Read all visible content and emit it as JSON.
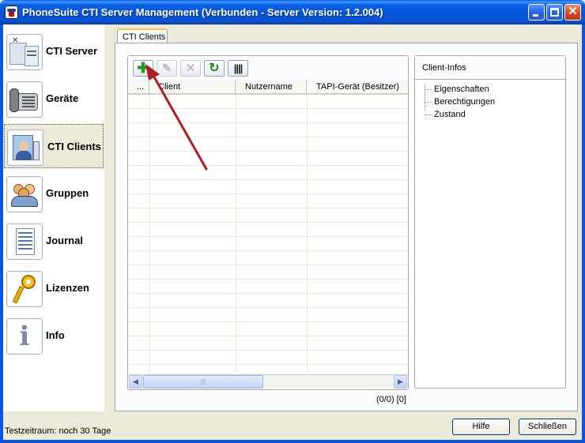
{
  "window": {
    "title": "PhoneSuite CTI Server Management (Verbunden - Server Version: 1.2.004)"
  },
  "nav": {
    "items": [
      {
        "label": "CTI Server",
        "icon": "server-icon"
      },
      {
        "label": "Geräte",
        "icon": "phone-icon"
      },
      {
        "label": "CTI Clients",
        "icon": "client-user-icon",
        "selected": true
      },
      {
        "label": "Gruppen",
        "icon": "group-icon"
      },
      {
        "label": "Journal",
        "icon": "journal-icon"
      },
      {
        "label": "Lizenzen",
        "icon": "key-icon"
      },
      {
        "label": "Info",
        "icon": "info-icon"
      }
    ]
  },
  "tab": {
    "label": "CTI Clients"
  },
  "toolbar": {
    "tools": [
      "add-icon",
      "edit-icon",
      "delete-icon",
      "refresh-icon",
      "columns-icon"
    ]
  },
  "grid": {
    "columns": [
      "...",
      "Client",
      "Nutzername",
      "TAPI-Gerät (Besitzer)"
    ],
    "rows": []
  },
  "counter": "(0/0) [0]",
  "client_infos": {
    "title": "Client-Infos",
    "items": [
      "Eigenschaften",
      "Berechtigungen",
      "Zustand"
    ]
  },
  "status": "Testzeitraum: noch 30 Tage",
  "buttons": {
    "help": "Hilfe",
    "close": "Schließen"
  },
  "colors": {
    "title_bar": "#0a56e0",
    "accent": "#f5c34a",
    "arrow": "#b01c22"
  }
}
